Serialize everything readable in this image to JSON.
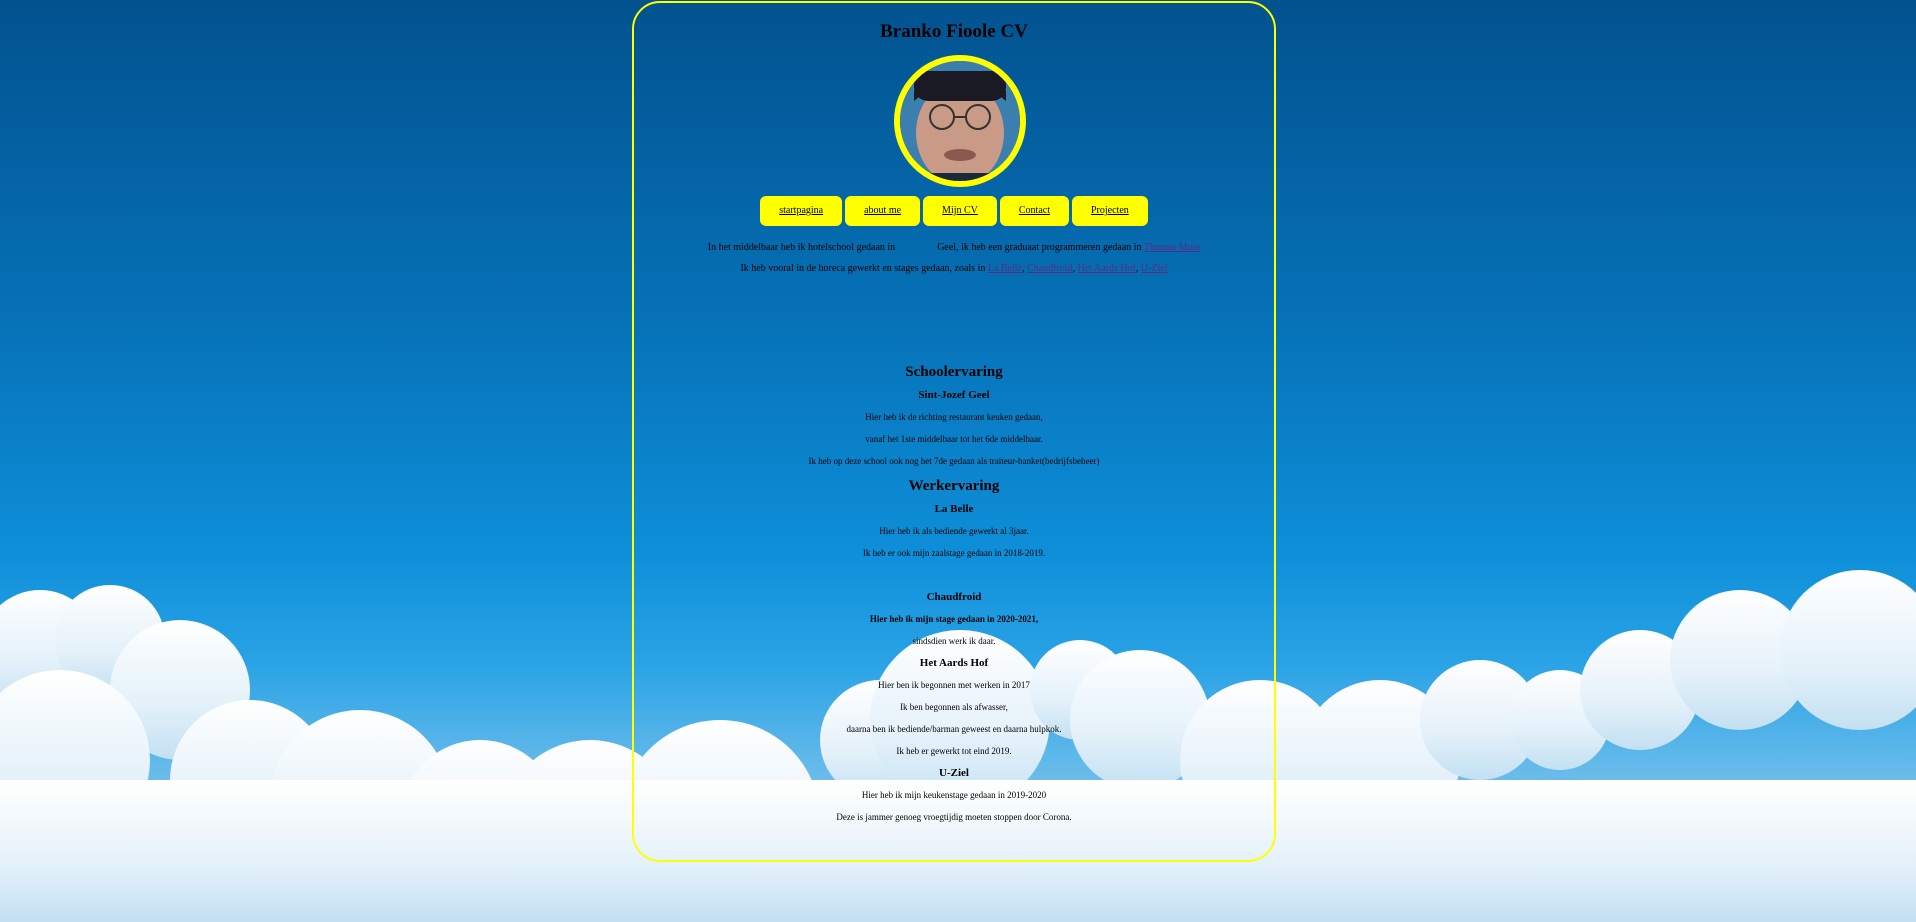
{
  "page": {
    "title": "Branko Fioole CV",
    "accent_color": "#ffff00",
    "link_color": "#5b2a86"
  },
  "nav": {
    "items": [
      {
        "label": "startpagina"
      },
      {
        "label": "about me"
      },
      {
        "label": "Mijn CV"
      },
      {
        "label": "Contact"
      },
      {
        "label": "Projecten"
      }
    ]
  },
  "intro": {
    "line1_prefix": "In het middelbaar heb ik hotelschool gedaan in",
    "line1_middle": "Geel, ik heb een graduaat programmeren gedaan in",
    "line1_link": "Thomas More",
    "line2_prefix": "Ik heb vooral in de horeca gewerkt en stages gedaan, zoals in",
    "links": [
      "La Belle",
      "Chaudfroid",
      "Het Aards Hof",
      "U-Ziel"
    ],
    "separator": ", "
  },
  "school": {
    "heading": "Schoolervaring",
    "name": "Sint-Jozef Geel",
    "lines": [
      "Hier heb ik de richting restaurant keuken gedaan,",
      "vanaf het 1ste middelbaar tot het 6de middelbaar.",
      "Ik heb op deze school ook nog het 7de gedaan als traiteur-banket(bedrijfsbeheer)"
    ]
  },
  "work": {
    "heading": "Werkervaring",
    "jobs": [
      {
        "name": "La Belle",
        "lines": [
          "Hier heb ik als bediende gewerkt al 3jaar.",
          "Ik heb er ook mijn zaalstage gedaan in 2018-2019."
        ]
      },
      {
        "name": "Chaudfroid",
        "bold_line": "Hier heb ik mijn stage gedaan in 2020-2021,",
        "lines": [
          "sindsdien werk ik daar."
        ]
      },
      {
        "name": "Het Aards Hof",
        "lines": [
          "Hier ben ik begonnen met werken in 2017",
          "Ik ben begonnen als afwasser,",
          "daarna ben ik bediende/barman geweest en daarna hulpkok.",
          "Ik heb er gewerkt tot eind 2019."
        ]
      },
      {
        "name": "U-Ziel",
        "lines": [
          "Hier heb ik mijn keukenstage gedaan in 2019-2020",
          "Deze is jammer genoeg vroegtijdig moeten stoppen door Corona."
        ]
      }
    ]
  },
  "avatar": {
    "icon": "profile-photo"
  }
}
